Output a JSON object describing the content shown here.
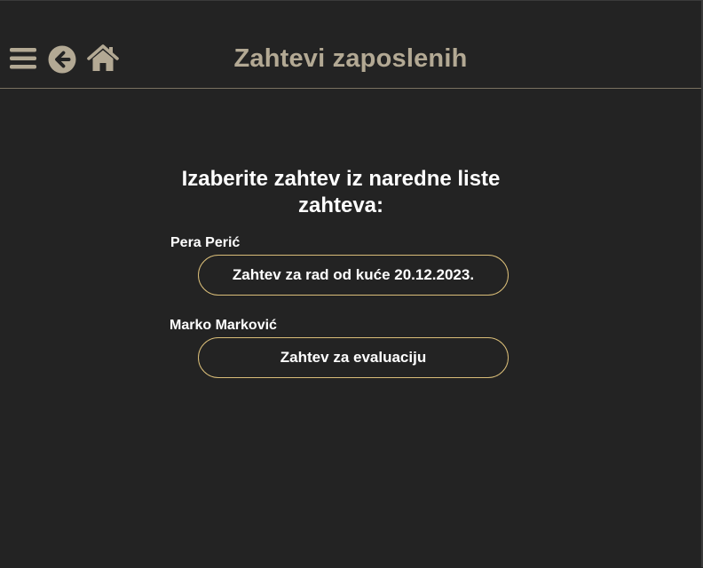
{
  "header": {
    "title": "Zahtevi zaposlenih",
    "icons": [
      "menu-icon",
      "back-icon",
      "home-icon"
    ],
    "icon_color": "#b3a994",
    "border_color": "#7a7260"
  },
  "main": {
    "prompt": "Izaberite zahtev iz naredne liste zahteva:",
    "requests": [
      {
        "employee": "Pera Perić",
        "label": "Zahtev za rad od kuće 20.12.2023."
      },
      {
        "employee": "Marko Marković",
        "label": "Zahtev za evaluaciju"
      }
    ]
  },
  "colors": {
    "background": "#232323",
    "accent": "#d9bd78",
    "text": "#ffffff"
  }
}
